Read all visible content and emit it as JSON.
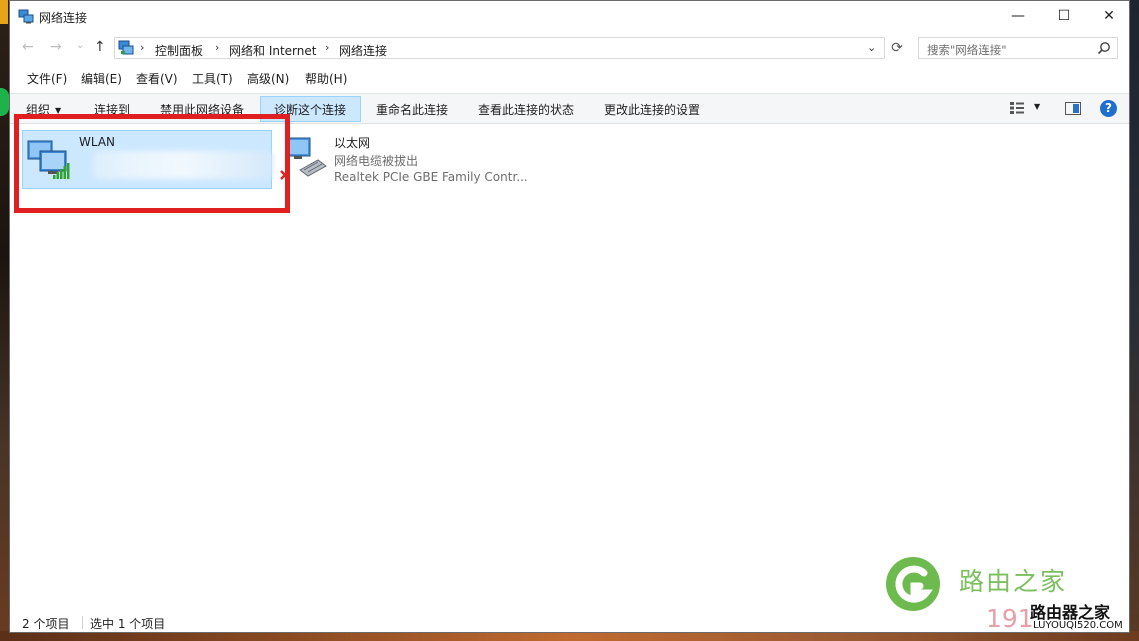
{
  "window": {
    "title": "网络连接",
    "min_icon": "—",
    "max_icon": "☐",
    "close_icon": "✕"
  },
  "nav": {
    "back": "←",
    "forward": "→",
    "recent": "⌄",
    "up": "↑"
  },
  "address": {
    "crumbs": [
      "控制面板",
      "网络和 Internet",
      "网络连接"
    ],
    "separator": "›",
    "dropdown": "⌄"
  },
  "refresh_icon": "⟳",
  "search": {
    "placeholder": "搜索\"网络连接\""
  },
  "menu": [
    "文件(F)",
    "编辑(E)",
    "查看(V)",
    "工具(T)",
    "高级(N)",
    "帮助(H)"
  ],
  "commands": {
    "organize": "组织",
    "connect": "连接到",
    "disable": "禁用此网络设备",
    "diagnose": "诊断这个连接",
    "rename": "重命名此连接",
    "status": "查看此连接的状态",
    "settings": "更改此连接的设置",
    "help": "?"
  },
  "connections": [
    {
      "name": "WLAN",
      "selected": true
    },
    {
      "name": "以太网",
      "status": "网络电缆被拔出",
      "adapter": "Realtek PCIe GBE Family Contr...",
      "selected": false
    }
  ],
  "status": {
    "count": "2 个项目",
    "selected": "选中 1 个项目"
  },
  "watermark": {
    "brand": "路由之家",
    "number": "191",
    "dark": "路由器之家",
    "url": "LUYOUQI520.COM"
  },
  "colors": {
    "selection": "#cce8ff",
    "selection_border": "#99d1ff",
    "highlight": "#e02020",
    "watermark_green": "#7bbf5e"
  }
}
